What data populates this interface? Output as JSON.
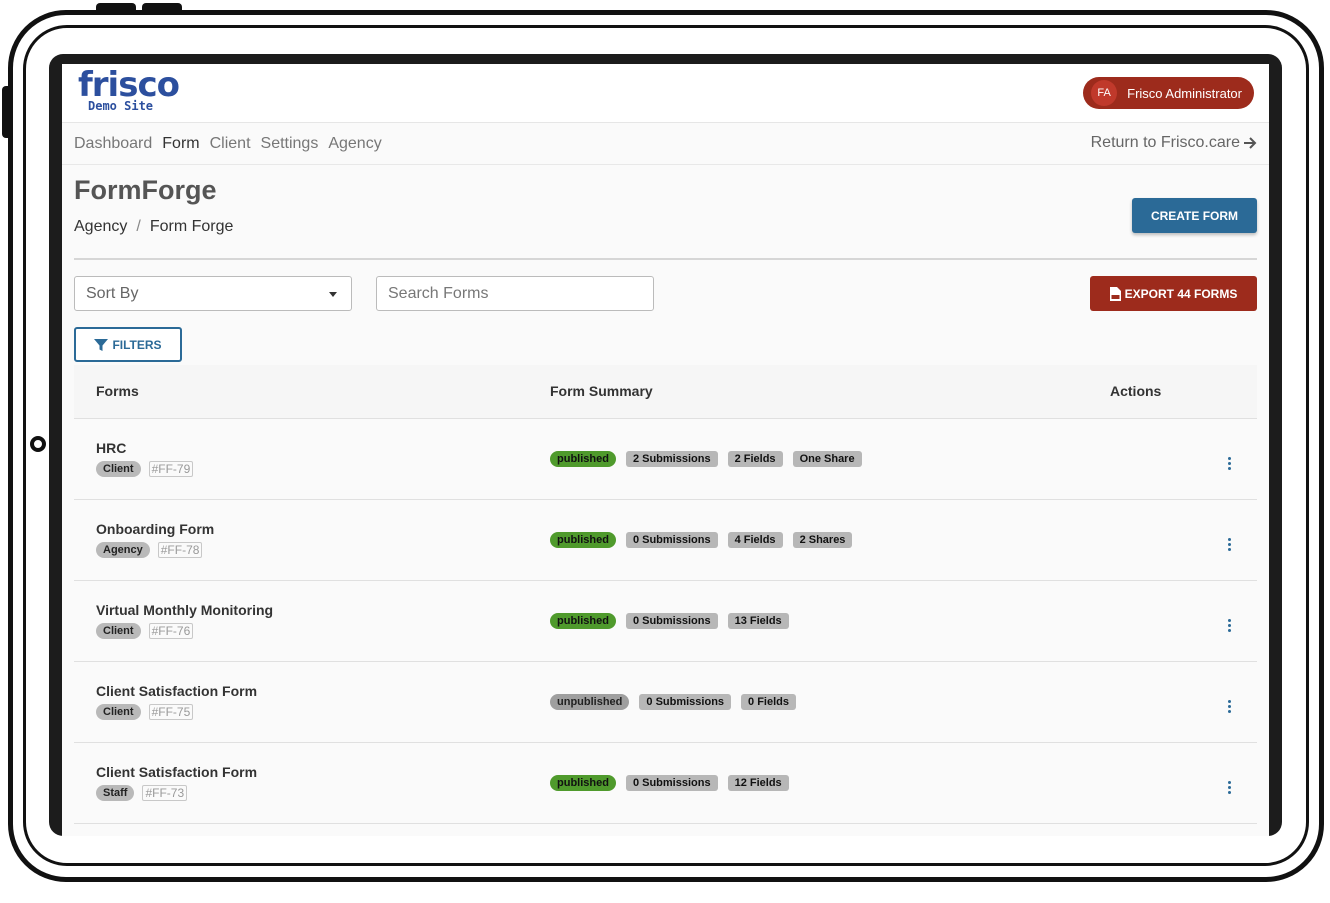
{
  "brand": {
    "logo_main": "frisco",
    "logo_sub": "Demo Site",
    "color": "#2c4f9e"
  },
  "user": {
    "initials": "FA",
    "name": "Frisco Administrator"
  },
  "nav": {
    "items": [
      "Dashboard",
      "Form",
      "Client",
      "Settings",
      "Agency"
    ],
    "active": "Form",
    "return_label": "Return to Frisco.care"
  },
  "header": {
    "title": "FormForge",
    "breadcrumb": [
      "Agency",
      "Form Forge"
    ],
    "breadcrumb_sep": "/",
    "create_label": "CREATE FORM"
  },
  "controls": {
    "sort_label": "Sort By",
    "search_placeholder": "Search Forms",
    "export_label": "EXPORT 44 FORMS",
    "filters_label": "FILTERS"
  },
  "table": {
    "columns": [
      "Forms",
      "Form Summary",
      "Actions"
    ],
    "rows": [
      {
        "name": "HRC",
        "tag": "Client",
        "code": "#FF-79",
        "badges": [
          "published",
          "2 Submissions",
          "2 Fields",
          "One Share"
        ]
      },
      {
        "name": "Onboarding Form",
        "tag": "Agency",
        "code": "#FF-78",
        "badges": [
          "published",
          "0 Submissions",
          "4 Fields",
          "2 Shares"
        ]
      },
      {
        "name": "Virtual Monthly Monitoring",
        "tag": "Client",
        "code": "#FF-76",
        "badges": [
          "published",
          "0 Submissions",
          "13 Fields"
        ]
      },
      {
        "name": "Client Satisfaction Form",
        "tag": "Client",
        "code": "#FF-75",
        "badges": [
          "unpublished",
          "0 Submissions",
          "0 Fields"
        ]
      },
      {
        "name": "Client Satisfaction Form",
        "tag": "Staff",
        "code": "#FF-73",
        "badges": [
          "published",
          "0 Submissions",
          "12 Fields"
        ]
      }
    ]
  },
  "colors": {
    "primary": "#2b6a97",
    "danger": "#9d2b1c",
    "published": "#4f9a2c"
  }
}
